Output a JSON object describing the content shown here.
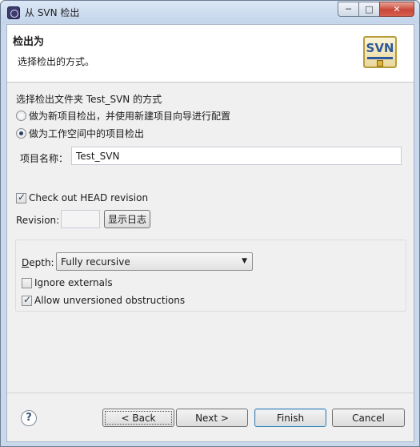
{
  "window": {
    "title": "从 SVN 检出",
    "controls": {
      "minimize": "─",
      "maximize": "□",
      "close": "✕"
    }
  },
  "banner": {
    "title": "检出为",
    "description": "选择检出的方式。",
    "logo_text": "SVN"
  },
  "checkout": {
    "section_label": "选择检出文件夹 Test_SVN 的方式",
    "options": [
      {
        "label": "做为新项目检出，并使用新建项目向导进行配置",
        "selected": false
      },
      {
        "label": "做为工作空间中的项目检出",
        "selected": true
      }
    ],
    "project_name_label": "项目名称：",
    "project_name_value": "Test_SVN"
  },
  "revision": {
    "head_checkbox": {
      "label": "Check out HEAD revision",
      "checked": true
    },
    "revision_label": "Revision:",
    "revision_value": "",
    "show_log_button": "显示日志"
  },
  "options": {
    "depth_label": "Depth:",
    "depth_value": "Fully recursive",
    "ignore_externals": {
      "label": "Ignore externals",
      "checked": false
    },
    "allow_unversioned": {
      "label": "Allow unversioned obstructions",
      "checked": true
    }
  },
  "footer": {
    "help_icon": "?",
    "back_button": "< Back",
    "next_button": "Next >",
    "finish_button": "Finish",
    "cancel_button": "Cancel"
  },
  "colors": {
    "title_bar": "#c3d4ea",
    "dialog_bg": "#f0f0f0",
    "default_button_border": "#3c7fb1",
    "close_button": "#c8483a"
  }
}
